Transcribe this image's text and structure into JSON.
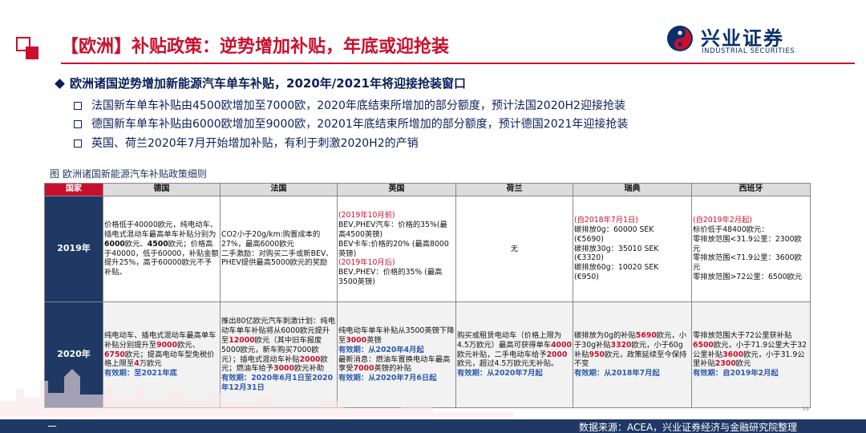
{
  "header": {
    "title": "【欧洲】补贴政策：逆势增加补贴，年底或迎抢装",
    "logo": {
      "cn": "兴业证券",
      "en": "INDUSTRIAL SECURITIES",
      "icon": "company-logo-icon"
    }
  },
  "bullets": {
    "main": "欧洲诸国逆势增加新能源汽车单车补贴，2020年/2021年将迎接抢装窗口",
    "items": [
      "法国新车单车补贴由4500欧增加至7000欧，2020年底结束所增加的部分额度，预计法国2020H2迎接抢装",
      "德国新车单车补贴由6000欧增加至9000欧，20201年底结束所增加的部分额度，预计德国2021年迎接抢装",
      "英国、荷兰2020年7月开始增加补贴，有利于刺激2020H2的产销"
    ]
  },
  "figure": {
    "title": "图 欧洲诸国新能源汽车补贴政策细则",
    "headers": [
      "国家",
      "德国",
      "法国",
      "英国",
      "荷兰",
      "瑞典",
      "西班牙"
    ],
    "years": [
      "2019年",
      "2020年"
    ],
    "rows": {
      "y2019": {
        "germany": {
          "a": "价格低于40000欧元，纯电动车、插电式混动车最高单车补贴分别为",
          "b": "6000",
          "c": "欧元、",
          "d": "4500",
          "e": "欧元；价格高于40000，低于60000，补贴金额提升25%，高于60000欧元不予补贴。"
        },
        "france": "CO2小于20g/km:购置成本的27%，最高6000欧元\n二手激励：对购买二手或新BEV、PHEV提供最高5000欧元的奖励",
        "uk": {
          "d1": "(2019年10月前)",
          "t1": "BEV,PHEV汽车：价格的35%(最高4500英镑)\nBEV卡车:价格的20% (最高8000英镑)",
          "d2": "(2019年10月后)",
          "t2": "BEV,PHEV：价格的35% (最高3500英镑)"
        },
        "netherlands": "无",
        "sweden": {
          "d": "(自2018年7月1日)",
          "t": "碳排放0g：60000 SEK\n(€5690)\n碳排放30g：35010 SEK\n(€3320)\n碳排放60g：10020 SEK\n(€950)"
        },
        "spain": {
          "d": "(自2019年2月起)",
          "t": "标价低于48400欧元：\n零排放范围<31.9公里：2300欧元\n零排放范围<71.9公里：3600欧元\n零排放范围>72公里：6500欧元"
        }
      },
      "y2020": {
        "germany": {
          "a": "纯电动车、插电式混动车最高单车补贴分别提升至",
          "b": "9000",
          "c": "欧元、",
          "d": "6750",
          "e": "欧元；提高电动车型免税价格上限至",
          "f": "4",
          "g": "万欧元",
          "valid": "有效期：至2021年底"
        },
        "france": {
          "a": "推出80亿欧元汽车刺激计划：纯电动车单车补贴将从6000欧元提升至",
          "b": "12000",
          "c": "欧元（其中旧车报废5000欧元，新车购买7000欧元）；插电式混动车补贴",
          "d": "2000",
          "e": "欧元；燃油车给予",
          "f": "3000",
          "g": "欧元补助",
          "valid": "有效期：2020年6月1日至2020年12月31日"
        },
        "uk": {
          "a": "纯电动车单车补贴从3500英镑下降至",
          "b": "3000",
          "c": "英镑",
          "valid1": "有效期：从2020年4月起",
          "d": "最新消息：燃油车置换电动车最高享受",
          "e": "7000",
          "f": "英镑的补贴",
          "valid2": "有效期：从2020年7月6日起"
        },
        "netherlands": {
          "a": "购买或租赁电动车（价格上限为4.5万欧元）最高可获得单车",
          "b": "4000",
          "c": "欧元补贴，二手电动车给予",
          "d": "2000",
          "e": "欧元，超过4.5万欧元无补贴。",
          "valid": "有效期：从2020年7月起"
        },
        "sweden": {
          "a": "碳排放为0g的补贴",
          "b": "5690",
          "c": "欧元，小于30g补贴",
          "d": "3320",
          "e": "欧元，小于60g补贴",
          "f": "950",
          "g": "欧元，政策延续至今保持不变",
          "valid": "有效期：从2018年7月起"
        },
        "spain": {
          "a": "零排放范围大于72公里获补贴",
          "b": "6500",
          "c": "欧元，小于71.9公里大于32公里补贴",
          "d": "3600",
          "e": "欧元，小于31.9公里补贴",
          "f": "2300",
          "g": "欧元",
          "valid": "有效期：自2019年2月起"
        }
      }
    }
  },
  "footer": {
    "page_number": "39",
    "source": "数据来源：ACEA，兴业证券经济与金融研究院整理"
  },
  "colors": {
    "brand_red": "#c8102e",
    "navy": "#1f3864",
    "text_navy": "#0a1f5c",
    "highlight_blue": "#2e5aac"
  }
}
